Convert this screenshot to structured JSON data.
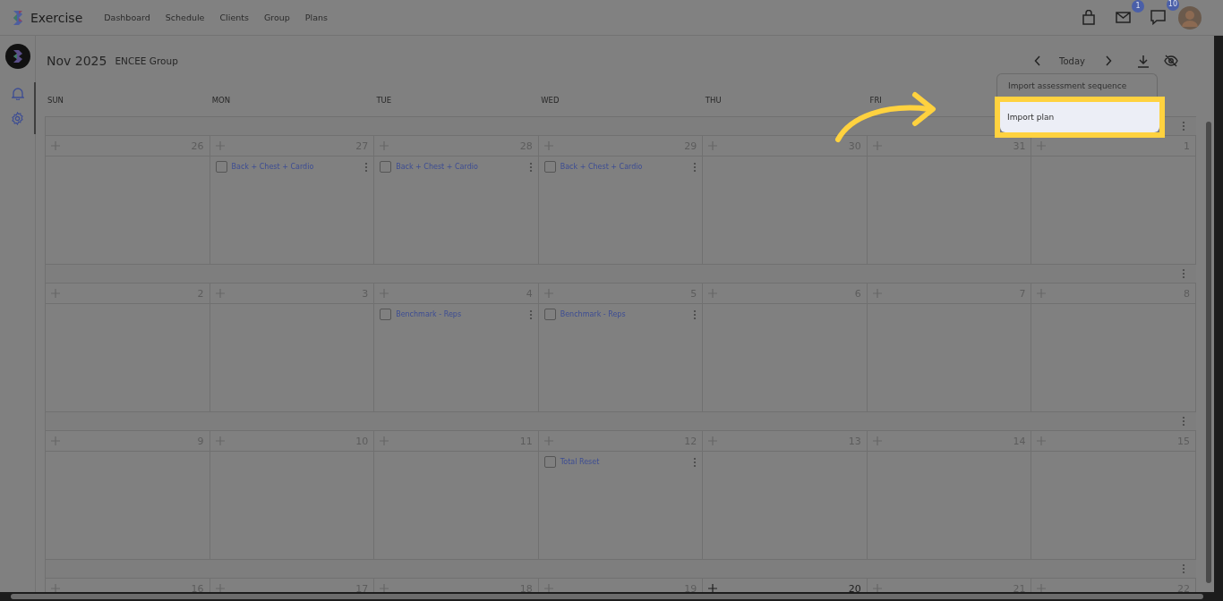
{
  "app": {
    "name": "Exercise"
  },
  "nav": [
    {
      "label": "Dashboard"
    },
    {
      "label": "Schedule"
    },
    {
      "label": "Clients"
    },
    {
      "label": "Group"
    },
    {
      "label": "Plans"
    }
  ],
  "header_icons": [
    {
      "kind": "bag"
    },
    {
      "kind": "mail",
      "badge": "1"
    },
    {
      "kind": "chat",
      "badge": "10"
    }
  ],
  "calendar": {
    "month": "Nov 2025",
    "group": "ENCEE Group",
    "today_button": "Today",
    "weekdays": [
      "SUN",
      "MON",
      "TUE",
      "WED",
      "THU",
      "FRI"
    ],
    "weeks": [
      {
        "days": [
          {
            "date": "26",
            "today": false
          },
          {
            "date": "27",
            "today": false,
            "events": [
              {
                "title": "Back + Chest + Cardio",
                "checked": false
              }
            ]
          },
          {
            "date": "28",
            "today": false,
            "events": [
              {
                "title": "Back + Chest + Cardio",
                "checked": false
              }
            ]
          },
          {
            "date": "29",
            "today": false,
            "events": [
              {
                "title": "Back + Chest + Cardio",
                "checked": false
              }
            ]
          },
          {
            "date": "30",
            "today": false
          },
          {
            "date": "31",
            "today": false
          },
          {
            "date": "1",
            "today": false
          }
        ]
      },
      {
        "days": [
          {
            "date": "2",
            "today": false
          },
          {
            "date": "3",
            "today": false
          },
          {
            "date": "4",
            "today": false,
            "events": [
              {
                "title": "Benchmark - Reps",
                "checked": false
              }
            ]
          },
          {
            "date": "5",
            "today": false,
            "events": [
              {
                "title": "Benchmark - Reps",
                "checked": false
              }
            ]
          },
          {
            "date": "6",
            "today": false
          },
          {
            "date": "7",
            "today": false
          },
          {
            "date": "8",
            "today": false
          }
        ]
      },
      {
        "days": [
          {
            "date": "9",
            "today": false
          },
          {
            "date": "10",
            "today": false
          },
          {
            "date": "11",
            "today": false
          },
          {
            "date": "12",
            "today": false,
            "events": [
              {
                "title": "Total Reset",
                "checked": false
              }
            ]
          },
          {
            "date": "13",
            "today": false
          },
          {
            "date": "14",
            "today": false
          },
          {
            "date": "15",
            "today": false
          }
        ]
      },
      {
        "days": [
          {
            "date": "16",
            "today": false
          },
          {
            "date": "17",
            "today": false
          },
          {
            "date": "18",
            "today": false
          },
          {
            "date": "19",
            "today": false
          },
          {
            "date": "20",
            "today": true
          },
          {
            "date": "21",
            "today": false
          },
          {
            "date": "22",
            "today": false
          }
        ]
      }
    ]
  },
  "menu": [
    {
      "label": "Import assessment sequence",
      "highlighted": false
    },
    {
      "label": "Import plan",
      "highlighted": true
    }
  ]
}
